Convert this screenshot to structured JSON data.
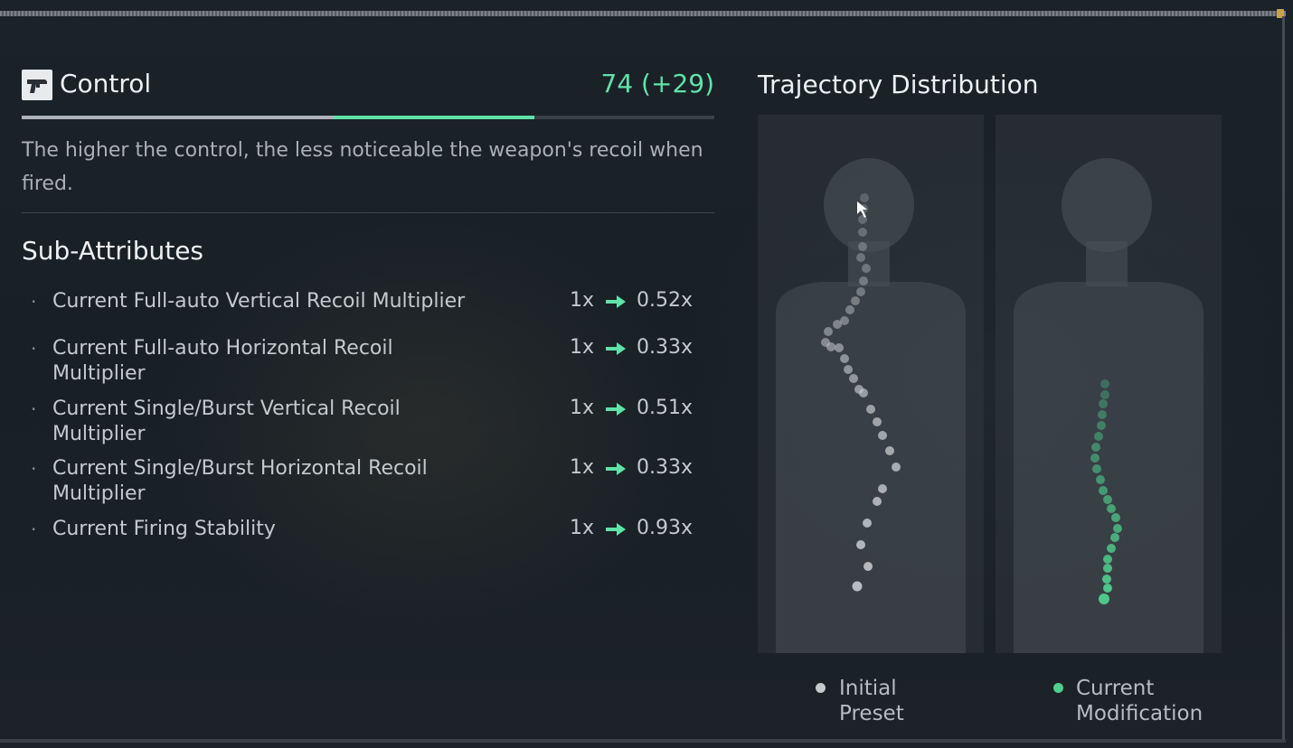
{
  "header": {
    "icon": "pistol-icon",
    "title": "Control",
    "score": "74 (+29)",
    "base_value": 45,
    "gain": 29,
    "max_value": 100
  },
  "description": "The higher the control, the less noticeable the weapon's recoil when fired.",
  "sub_attributes": {
    "heading": "Sub-Attributes",
    "items": [
      {
        "name": "Current Full-auto Vertical Recoil Multiplier",
        "from": "1x",
        "to": "0.52x"
      },
      {
        "name": "Current Full-auto Horizontal Recoil Multiplier",
        "from": "1x",
        "to": "0.33x"
      },
      {
        "name": "Current Single/Burst Vertical Recoil Multiplier",
        "from": "1x",
        "to": "0.51x"
      },
      {
        "name": "Current Single/Burst Horizontal Recoil Multiplier",
        "from": "1x",
        "to": "0.33x"
      },
      {
        "name": "Current Firing Stability",
        "from": "1x",
        "to": "0.93x"
      }
    ]
  },
  "trajectory": {
    "title": "Trajectory Distribution",
    "legend": [
      {
        "label": "Initial\nPreset",
        "color": "#c7cacd"
      },
      {
        "label": "Current\nModification",
        "color": "#4fcf8e"
      }
    ]
  },
  "colors": {
    "accent": "#5fe3a8",
    "initial": "#c7cacd",
    "current": "#4fcf8e"
  }
}
